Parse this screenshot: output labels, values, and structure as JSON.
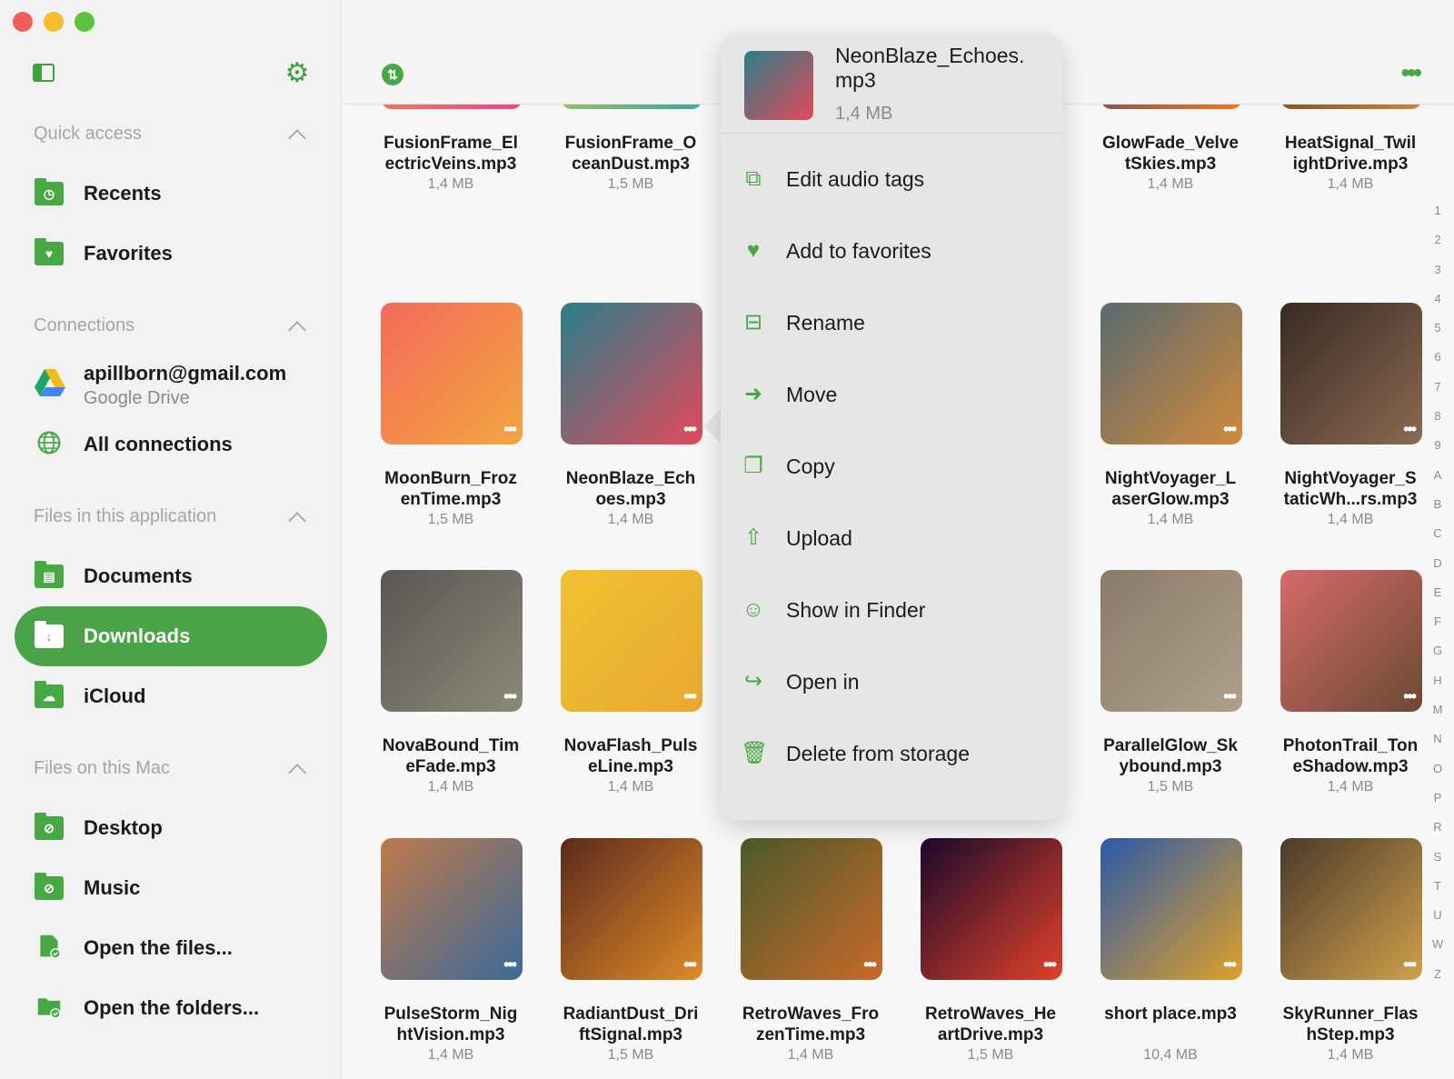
{
  "sidebar": {
    "quick_access": "Quick access",
    "recents": "Recents",
    "favorites": "Favorites",
    "connections": "Connections",
    "gdrive_email": "apillborn@gmail.com",
    "gdrive_label": "Google Drive",
    "all_connections": "All connections",
    "files_app": "Files in this application",
    "documents": "Documents",
    "downloads": "Downloads",
    "icloud": "iCloud",
    "files_mac": "Files on this Mac",
    "desktop": "Desktop",
    "music": "Music",
    "open_files": "Open the files...",
    "open_folders": "Open the folders..."
  },
  "accent_color": "#4aa346",
  "files": [
    {
      "name": "FusionFrame_El ectricVeins.mp3",
      "size": "1,4 MB",
      "colors": [
        "#f0a23a",
        "#e8478a"
      ]
    },
    {
      "name": "FusionFrame_O ceanDust.mp3",
      "size": "1,5 MB",
      "colors": [
        "#f5d23a",
        "#39a6a0"
      ]
    },
    {
      "name": "GlowFade_Velve tSkies.mp3",
      "size": "1,4 MB",
      "colors": [
        "#1c3a8a",
        "#f27a1a"
      ]
    },
    {
      "name": "HeatSignal_Twil ightDrive.mp3",
      "size": "1,4 MB",
      "colors": [
        "#3a2a1a",
        "#c9893a"
      ]
    },
    {
      "name": "MoonBurn_Froz enTime.mp3",
      "size": "1,5 MB",
      "colors": [
        "#f56a5a",
        "#f2a640"
      ]
    },
    {
      "name": "NeonBlaze_Ech oes.mp3",
      "size": "1,4 MB",
      "colors": [
        "#2a7e8a",
        "#e24a5a"
      ]
    },
    {
      "name": "NightVoyager_L aserGlow.mp3",
      "size": "1,4 MB",
      "colors": [
        "#5a6a70",
        "#d08a3a"
      ]
    },
    {
      "name": "NightVoyager_S taticWh...rs.mp3",
      "size": "1,4 MB",
      "colors": [
        "#3a2a22",
        "#8a6a52"
      ]
    },
    {
      "name": "NovaBound_Tim eFade.mp3",
      "size": "1,4 MB",
      "colors": [
        "#5a5652",
        "#8a8a7a"
      ]
    },
    {
      "name": "NovaFlash_Puls eLine.mp3",
      "size": "1,4 MB",
      "colors": [
        "#f2c232",
        "#e8a830"
      ]
    },
    {
      "name": "ParallelGlow_Sk ybound.mp3",
      "size": "1,5 MB",
      "colors": [
        "#8a7a68",
        "#b0a08a"
      ]
    },
    {
      "name": "PhotonTrail_Ton eShadow.mp3",
      "size": "1,4 MB",
      "colors": [
        "#d86a6a",
        "#6a4a32"
      ]
    },
    {
      "name": "PulseStorm_Nig htVision.mp3",
      "size": "1,4 MB",
      "colors": [
        "#c07a4a",
        "#3a6a9a"
      ]
    },
    {
      "name": "RadiantDust_Dri ftSignal.mp3",
      "size": "1,5 MB",
      "colors": [
        "#5a2a1a",
        "#e08a2a"
      ]
    },
    {
      "name": "RetroWaves_Fro zenTime.mp3",
      "size": "1,4 MB",
      "colors": [
        "#4a5a2a",
        "#c96a2a"
      ]
    },
    {
      "name": "RetroWaves_He artDrive.mp3",
      "size": "1,5 MB",
      "colors": [
        "#1a0a2a",
        "#e0402a"
      ]
    },
    {
      "name": "short place.mp3",
      "size": "10,4 MB",
      "colors": [
        "#2a5aa8",
        "#e0a02a"
      ]
    },
    {
      "name": "SkyRunner_Flas hStep.mp3",
      "size": "1,4 MB",
      "colors": [
        "#4a3a2a",
        "#d0a04a"
      ]
    }
  ],
  "alphabet": [
    "1",
    "2",
    "3",
    "4",
    "5",
    "6",
    "7",
    "8",
    "9",
    "A",
    "B",
    "C",
    "D",
    "E",
    "F",
    "G",
    "H",
    "M",
    "N",
    "O",
    "P",
    "R",
    "S",
    "T",
    "U",
    "W",
    "Z"
  ],
  "menu": {
    "title": "NeonBlaze_Echoes. mp3",
    "size": "1,4 MB",
    "items": [
      {
        "label": "Edit audio tags",
        "icon": "edit-tags-icon"
      },
      {
        "label": "Add to favorites",
        "icon": "heart-icon"
      },
      {
        "label": "Rename",
        "icon": "rename-icon"
      },
      {
        "label": "Move",
        "icon": "move-icon"
      },
      {
        "label": "Copy",
        "icon": "copy-icon"
      },
      {
        "label": "Upload",
        "icon": "upload-icon"
      },
      {
        "label": "Show in Finder",
        "icon": "finder-icon"
      },
      {
        "label": "Open in",
        "icon": "share-icon"
      },
      {
        "label": "Delete from storage",
        "icon": "trash-icon"
      }
    ]
  }
}
